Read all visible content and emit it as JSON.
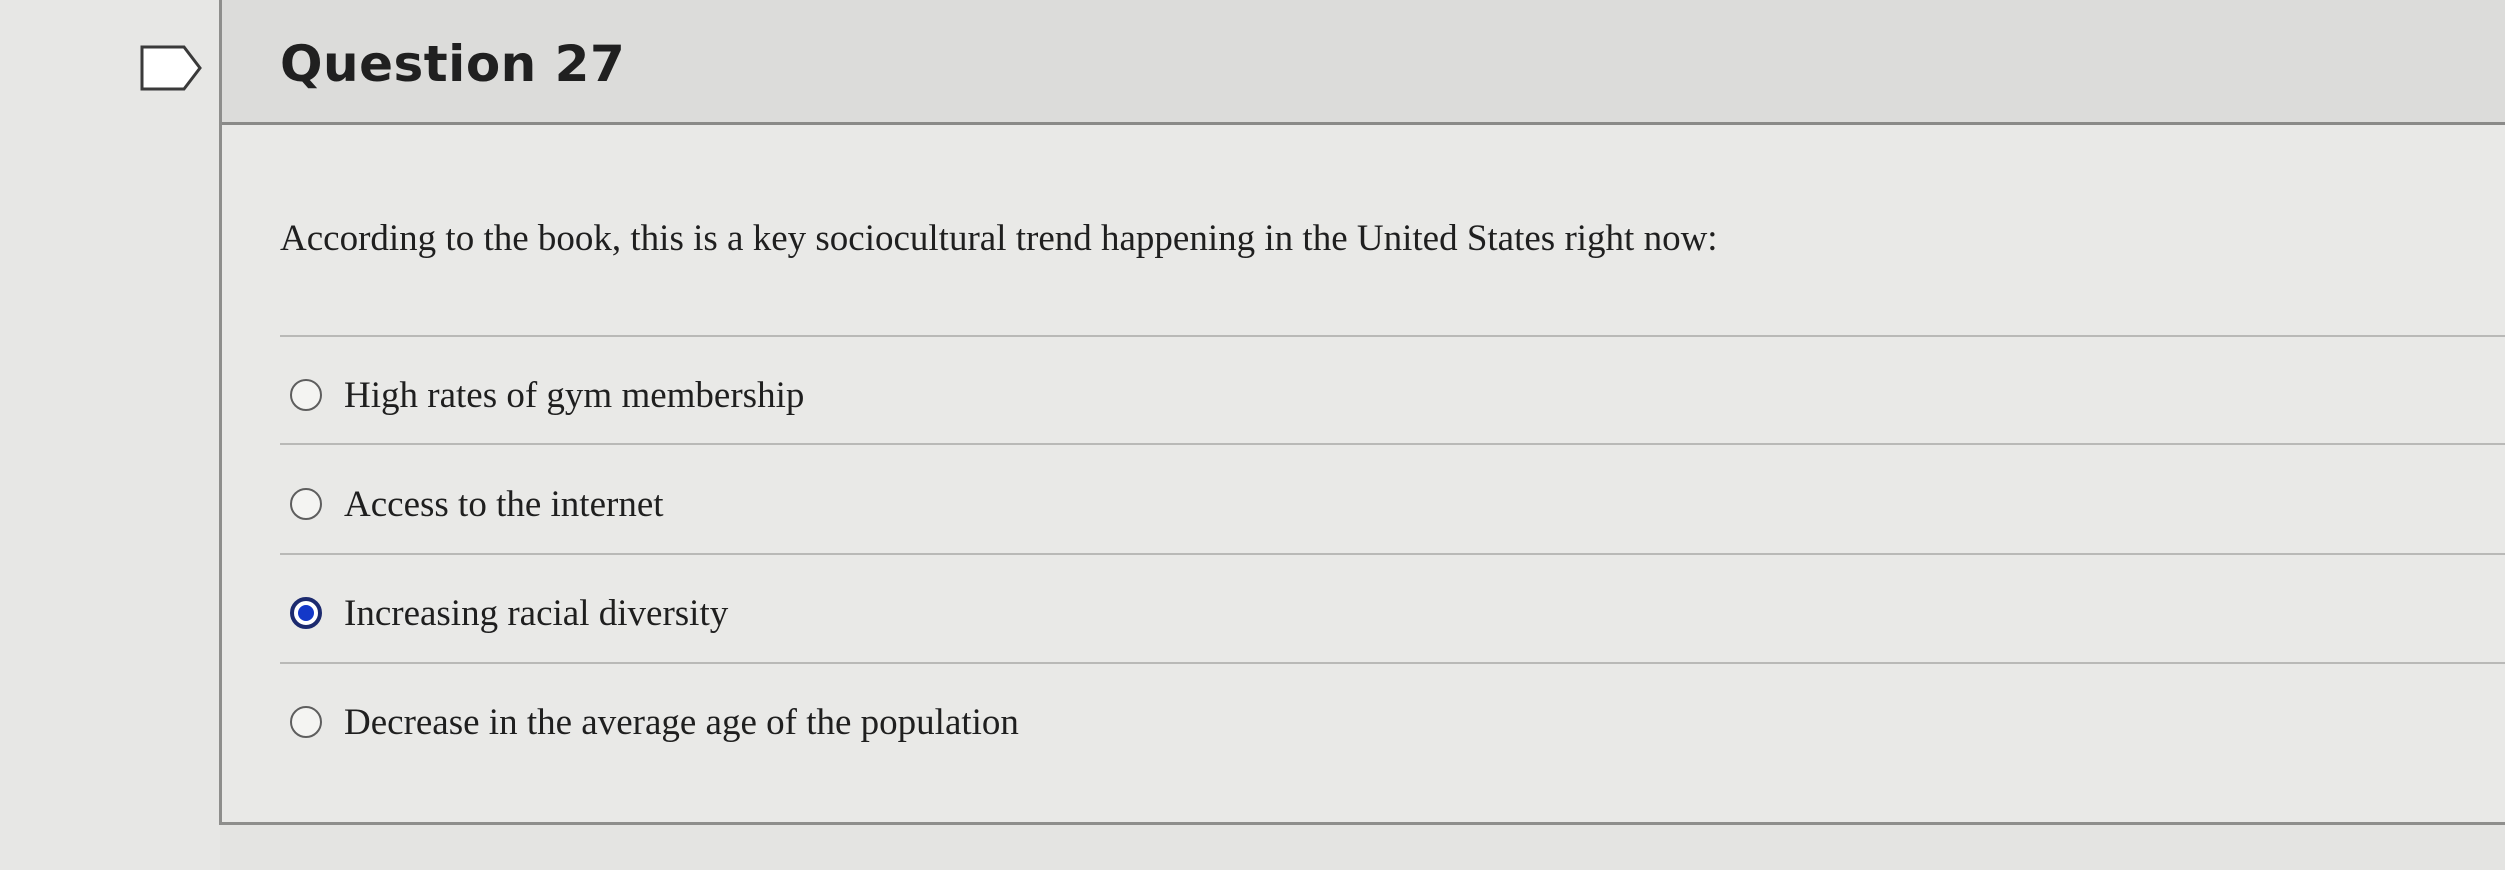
{
  "question": {
    "title": "Question 27",
    "text": "According to the book, this is a key sociocultural trend happening in the United States right now:"
  },
  "options": [
    {
      "label": "High rates of gym membership",
      "selected": false
    },
    {
      "label": "Access to the internet",
      "selected": false
    },
    {
      "label": "Increasing racial diversity",
      "selected": true
    },
    {
      "label": "Decrease in the average age of the population",
      "selected": false
    }
  ],
  "icons": {
    "flag": "flag-icon",
    "radio": "radio-button-icon"
  },
  "colors": {
    "radio_selected": "#1438c8",
    "radio_selected_ring": "#1c2a6e",
    "header_bg": "#dcdcda"
  }
}
